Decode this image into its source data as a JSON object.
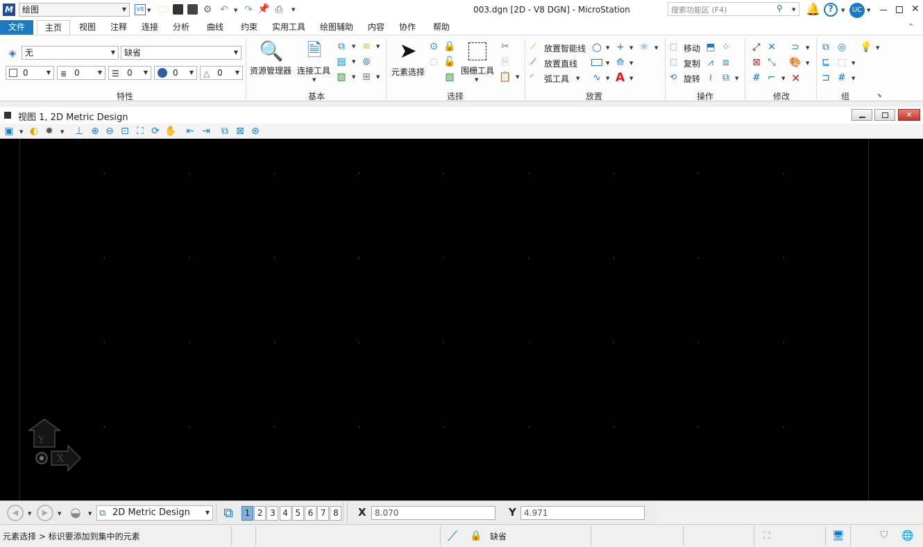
{
  "titlebar": {
    "workflow": "绘图",
    "v8_badge": "V8",
    "title": "003.dgn [2D - V8 DGN] - MicroStation",
    "search_placeholder": "搜索功能区 (F4)",
    "user_initials": "UC"
  },
  "tabs": [
    "文件",
    "主页",
    "视图",
    "注释",
    "连接",
    "分析",
    "曲线",
    "约束",
    "实用工具",
    "绘图辅助",
    "内容",
    "协作",
    "帮助"
  ],
  "active_tab": "主页",
  "ribbon": {
    "attributes": {
      "level": "无",
      "style_default": "缺省",
      "color": "0",
      "line_style": "0",
      "line_weight": "0",
      "transparency": "0",
      "priority": "0",
      "group_label": "特性"
    },
    "primary": {
      "explorer": "资源管理器",
      "attach_tools": "连接工具",
      "group_label": "基本"
    },
    "selection": {
      "element_selection": "元素选择",
      "fence_tool": "围栅工具",
      "group_label": "选择"
    },
    "placement": {
      "smartline": "放置智能线",
      "line": "放置直线",
      "arc_tools": "弧工具",
      "group_label": "放置"
    },
    "manipulate": {
      "move": "移动",
      "copy": "复制",
      "rotate": "旋转",
      "group_label": "操作"
    },
    "modify": {
      "group_label": "修改"
    },
    "groups": {
      "group_label": "组"
    }
  },
  "view": {
    "title": "视图 1, 2D Metric Design"
  },
  "bottom": {
    "model": "2D Metric Design",
    "view_numbers": [
      "1",
      "2",
      "3",
      "4",
      "5",
      "6",
      "7",
      "8"
    ],
    "active_view": "1",
    "x_label": "X",
    "x_value": "8.070",
    "y_label": "Y",
    "y_value": "4.971"
  },
  "status": {
    "prompt": "元素选择 > 标识要添加到集中的元素",
    "active_level": "缺省"
  },
  "colors": {
    "accent": "#1e7ac0",
    "canvas": "#000000"
  }
}
